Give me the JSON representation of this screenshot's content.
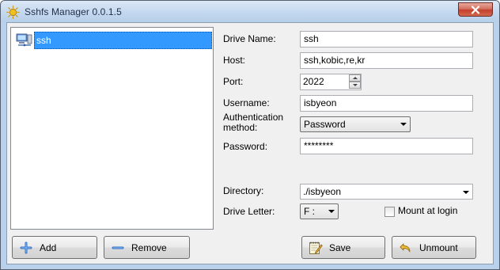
{
  "window": {
    "title": "Sshfs Manager 0.0.1.5"
  },
  "drives": [
    {
      "label": "ssh",
      "selected": true
    }
  ],
  "buttons": {
    "add": "Add",
    "remove": "Remove",
    "save": "Save",
    "unmount": "Unmount"
  },
  "form": {
    "drive_name": {
      "label": "Drive Name:",
      "value": "ssh"
    },
    "host": {
      "label": "Host:",
      "value": "ssh,kobic,re,kr"
    },
    "port": {
      "label": "Port:",
      "value": "2022"
    },
    "username": {
      "label": "Username:",
      "value": "isbyeon"
    },
    "auth_method": {
      "label_line1": "Authentication",
      "label_line2": "method:",
      "value": "Password"
    },
    "password": {
      "label": "Password:",
      "value": "********"
    },
    "directory": {
      "label": "Directory:",
      "value": "./isbyeon"
    },
    "drive_letter": {
      "label": "Drive Letter:",
      "value": "F :"
    },
    "mount_at_login": {
      "label": "Mount at login",
      "checked": false
    }
  },
  "colors": {
    "selection": "#3399ff",
    "client_bg": "#f0f0f0",
    "close_button": "#c2402c"
  }
}
